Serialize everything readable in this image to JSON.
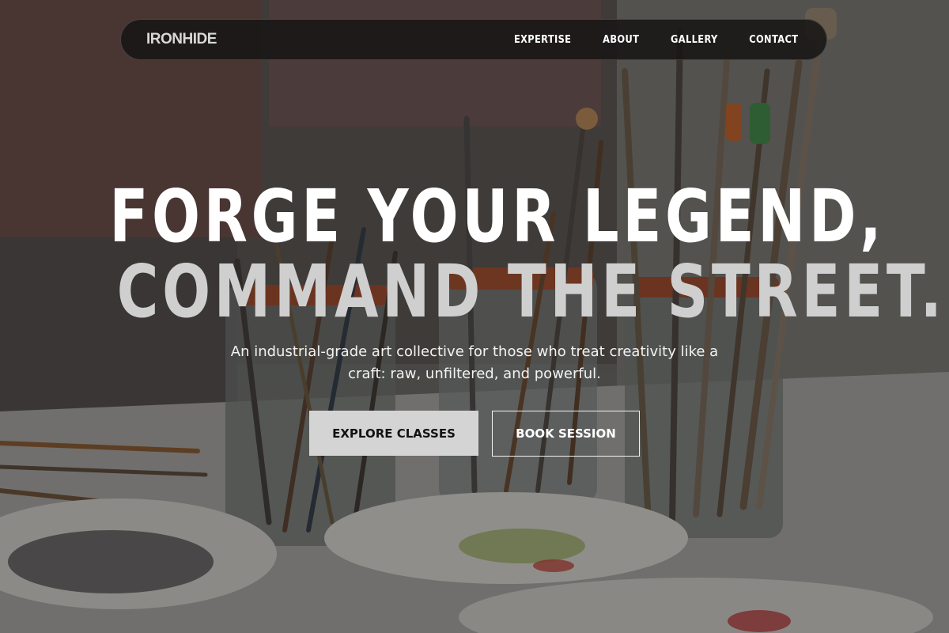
{
  "brand": {
    "logo": "IRONHIDE"
  },
  "nav": {
    "links": [
      "EXPERTISE",
      "ABOUT",
      "GALLERY",
      "CONTACT"
    ]
  },
  "hero": {
    "headline_line1": "FORGE YOUR LEGEND,",
    "headline_line2": "COMMAND THE STREET.",
    "subtitle": "An industrial-grade art collective for those who treat creativity like a craft: raw, unfiltered, and powerful.",
    "primary_cta": "EXPLORE CLASSES",
    "secondary_cta": "BOOK SESSION"
  },
  "colors": {
    "nav_bg": "#181616",
    "headline_primary": "#ffffff",
    "headline_secondary": "#cfcfcf",
    "button_primary_bg": "#d4d4d4",
    "button_primary_text": "#121212"
  },
  "background_image": "art-studio-paintbrush-jars-photo"
}
